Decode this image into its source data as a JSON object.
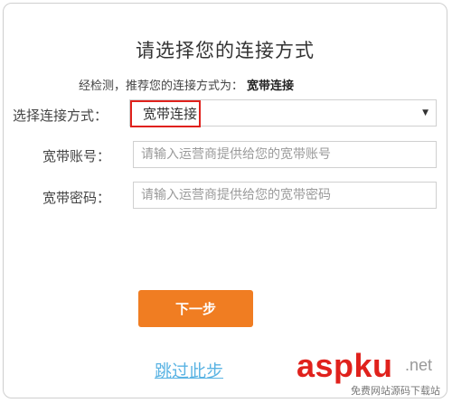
{
  "dialog": {
    "title": "请选择您的连接方式",
    "hint_prefix": "经检测，推荐您的连接方式为：",
    "hint_value": "宽带连接"
  },
  "form": {
    "connection": {
      "label": "选择连接方式：",
      "selected": "宽带连接",
      "icon": "dropdown-arrow-icon"
    },
    "account": {
      "label": "宽带账号：",
      "placeholder": "请输入运营商提供给您的宽带账号",
      "value": ""
    },
    "password": {
      "label": "宽带密码：",
      "placeholder": "请输入运营商提供给您的宽带密码",
      "value": ""
    }
  },
  "actions": {
    "next_label": "下一步",
    "skip_label": "跳过此步"
  },
  "watermark": {
    "logo": "aspku",
    "domain_suffix": ".net",
    "tagline": "免费网站源码下载站"
  },
  "colors": {
    "accent": "#f07d22",
    "link": "#5ab3e3",
    "highlight_border": "#e0211c"
  }
}
